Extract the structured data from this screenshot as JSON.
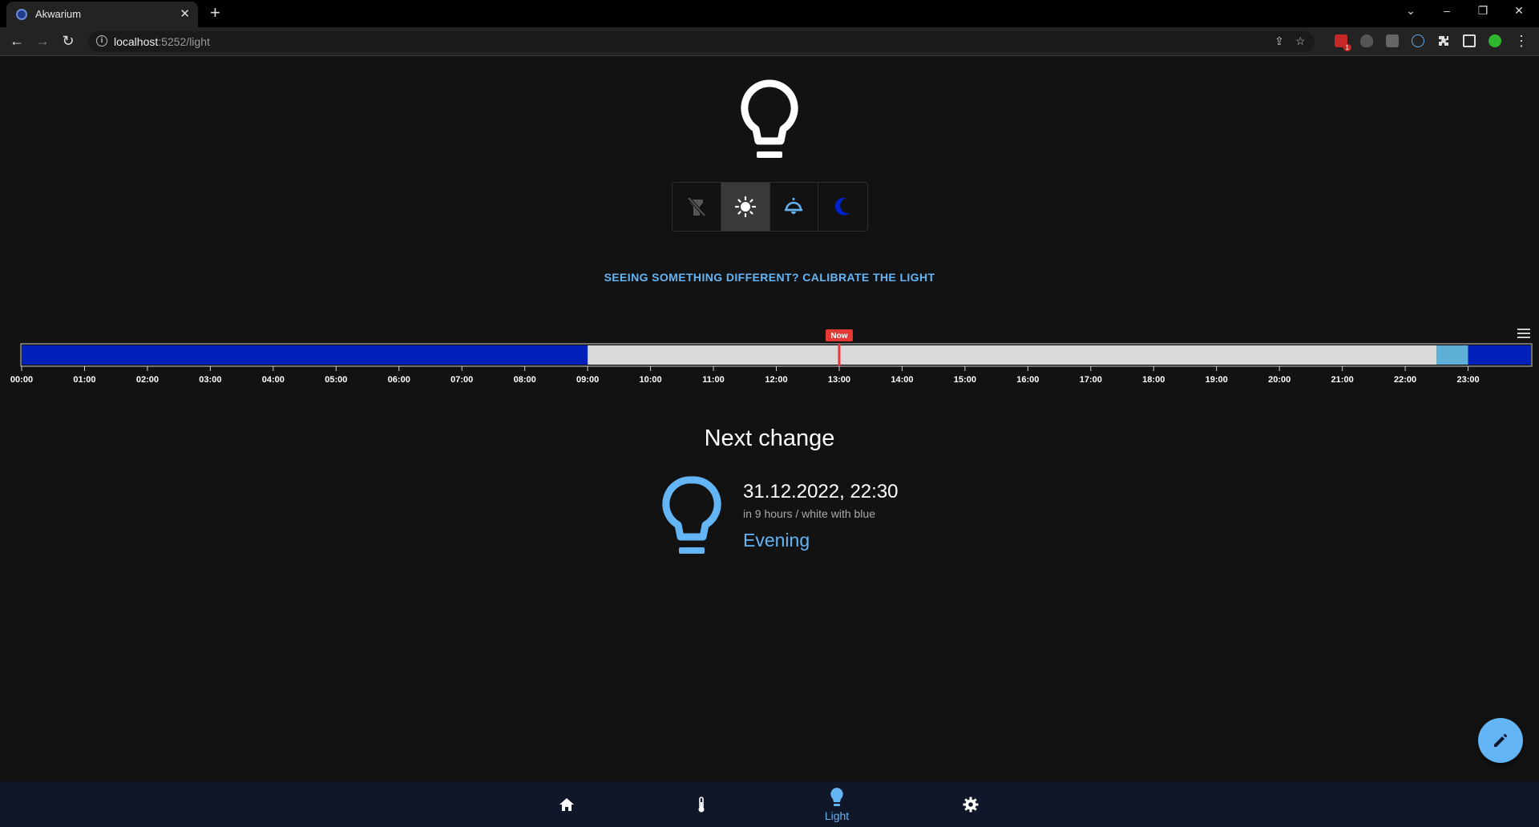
{
  "browser": {
    "tab_title": "Akwarium",
    "url_host": "localhost",
    "url_path": ":5252/light",
    "extension_badge": "1"
  },
  "page": {
    "calibrate_link": "SEEING SOMETHING DIFFERENT? CALIBRATE THE LIGHT",
    "modes": [
      {
        "name": "off",
        "icon": "flashlight-off-icon",
        "active": false
      },
      {
        "name": "day",
        "icon": "sun-icon",
        "active": true
      },
      {
        "name": "evening",
        "icon": "desk-lamp-icon",
        "active": false
      },
      {
        "name": "night",
        "icon": "moon-icon",
        "active": false
      }
    ],
    "colors": {
      "accent": "#64b5f6",
      "night": "#0022bb",
      "day": "#d9d9d9",
      "evening": "#5fb0d8",
      "now_marker": "#e53935"
    }
  },
  "chart_data": {
    "type": "timeline",
    "ticks": [
      "00:00",
      "01:00",
      "02:00",
      "03:00",
      "04:00",
      "05:00",
      "06:00",
      "07:00",
      "08:00",
      "09:00",
      "10:00",
      "11:00",
      "12:00",
      "13:00",
      "14:00",
      "15:00",
      "16:00",
      "17:00",
      "18:00",
      "19:00",
      "20:00",
      "21:00",
      "22:00",
      "23:00"
    ],
    "segments": [
      {
        "mode": "night",
        "start": 0,
        "end": 9,
        "color": "#0022bb"
      },
      {
        "mode": "day",
        "start": 9,
        "end": 22.5,
        "color": "#d9d9d9"
      },
      {
        "mode": "evening",
        "start": 22.5,
        "end": 23,
        "color": "#5fb0d8"
      },
      {
        "mode": "night",
        "start": 23,
        "end": 24,
        "color": "#0022bb"
      }
    ],
    "now": 13,
    "now_label": "Now",
    "xlim": [
      0,
      24
    ]
  },
  "next_change": {
    "title": "Next change",
    "datetime": "31.12.2022, 22:30",
    "subtitle": "in 9 hours / white with blue",
    "name": "Evening"
  },
  "bottom_nav": {
    "items": [
      {
        "name": "home",
        "icon": "home-icon",
        "label": ""
      },
      {
        "name": "temperature",
        "icon": "thermometer-icon",
        "label": ""
      },
      {
        "name": "light",
        "icon": "lightbulb-icon",
        "label": "Light"
      },
      {
        "name": "settings",
        "icon": "gear-icon",
        "label": ""
      }
    ]
  }
}
